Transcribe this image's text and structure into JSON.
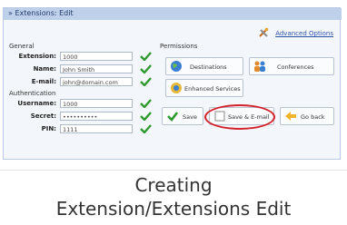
{
  "window": {
    "title": "» Extensions: Edit"
  },
  "header": {
    "advanced_options": "Advanced Options"
  },
  "general": {
    "section_label": "General",
    "extension_label": "Extension:",
    "extension_value": "1000",
    "name_label": "Name:",
    "name_value": "John Smith",
    "email_label": "E-mail:",
    "email_value": "john@domain.com"
  },
  "authentication": {
    "section_label": "Authentication",
    "username_label": "Username:",
    "username_value": "1000",
    "secret_label": "Secret:",
    "secret_value": "••••••••••",
    "pin_label": "PIN:",
    "pin_value": "1111"
  },
  "permissions": {
    "section_label": "Permissions",
    "destinations": "Destinations",
    "conferences": "Conferences",
    "enhanced_services": "Enhanced Services"
  },
  "actions": {
    "save": "Save",
    "save_and_email": "Save & E-mail",
    "go_back": "Go back"
  },
  "caption": {
    "line1": "Creating",
    "line2": "Extension/Extensions Edit"
  },
  "colors": {
    "title_bar": "#bfd0ea",
    "check": "#2e9a2e",
    "highlight": "#d4202a",
    "link": "#2c52a8"
  }
}
